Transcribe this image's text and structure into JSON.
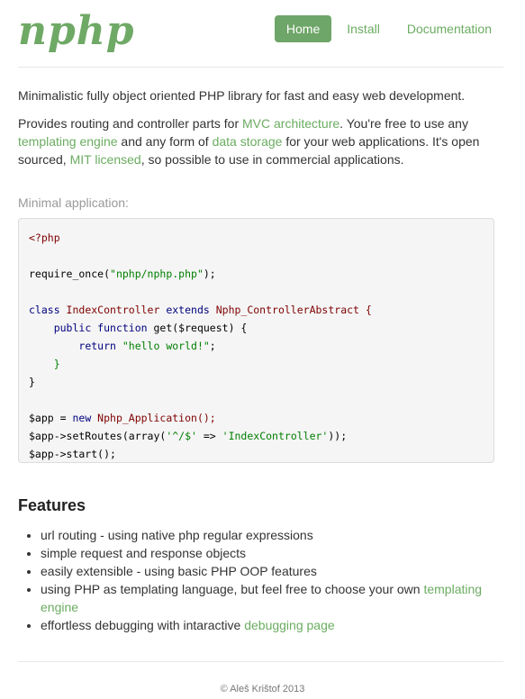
{
  "header": {
    "logo": "nphp",
    "nav": [
      {
        "label": "Home",
        "active": true
      },
      {
        "label": "Install",
        "active": false
      },
      {
        "label": "Documentation",
        "active": false
      }
    ]
  },
  "intro": {
    "line1": "Minimalistic fully object oriented PHP library for fast and easy web development.",
    "p2_a": "Provides routing and controller parts for ",
    "mvc_link": "MVC architecture",
    "p2_b": ". You're free to use any ",
    "templating_link": "templating engine",
    "p2_c": " and any form of ",
    "storage_link": "data storage",
    "p2_d": " for your web applications. It's open sourced, ",
    "mit_link": "MIT licensed",
    "p2_e": ", so possible to use in commercial applications."
  },
  "example": {
    "caption": "Minimal application:",
    "lines": {
      "l1": "<?php",
      "l3_fn": "require_once(",
      "l3_str": "\"nphp/nphp.php\"",
      "l3_end": ");",
      "l5_kw1": "class",
      "l5_name": " IndexController ",
      "l5_kw2": "extends",
      "l5_parent": " Nphp_ControllerAbstract {",
      "l6_indent": "    ",
      "l6_kw": "public function",
      "l6_rest": " get($request) {",
      "l7_indent": "        ",
      "l7_kw": "return",
      "l7_str": " \"hello world!\"",
      "l7_end": ";",
      "l8": "    }",
      "l9": "}",
      "l11_a": "$app = ",
      "l11_kw": "new",
      "l11_b": " Nphp_Application();",
      "l12_a": "$app->setRoutes(array(",
      "l12_str1": "'^/$'",
      "l12_b": " => ",
      "l12_str2": "'IndexController'",
      "l12_c": "));",
      "l13": "$app->start();"
    }
  },
  "features": {
    "heading": "Features",
    "items": {
      "i1": "url routing - using native php regular expressions",
      "i2": "simple request and response objects",
      "i3": "easily extensible - using basic PHP OOP features",
      "i4_text": "using PHP as templating language, but feel free to choose your own ",
      "i4_link": "templating engine",
      "i5_text": "effortless debugging with intaractive ",
      "i5_link": "debugging page"
    }
  },
  "footer": {
    "text": "© Aleš Krištof 2013"
  },
  "colors": {
    "accent": "#6ea568",
    "link": "#6bac61",
    "text": "#333333",
    "muted": "#999999",
    "code_bg": "#f5f5f5"
  }
}
